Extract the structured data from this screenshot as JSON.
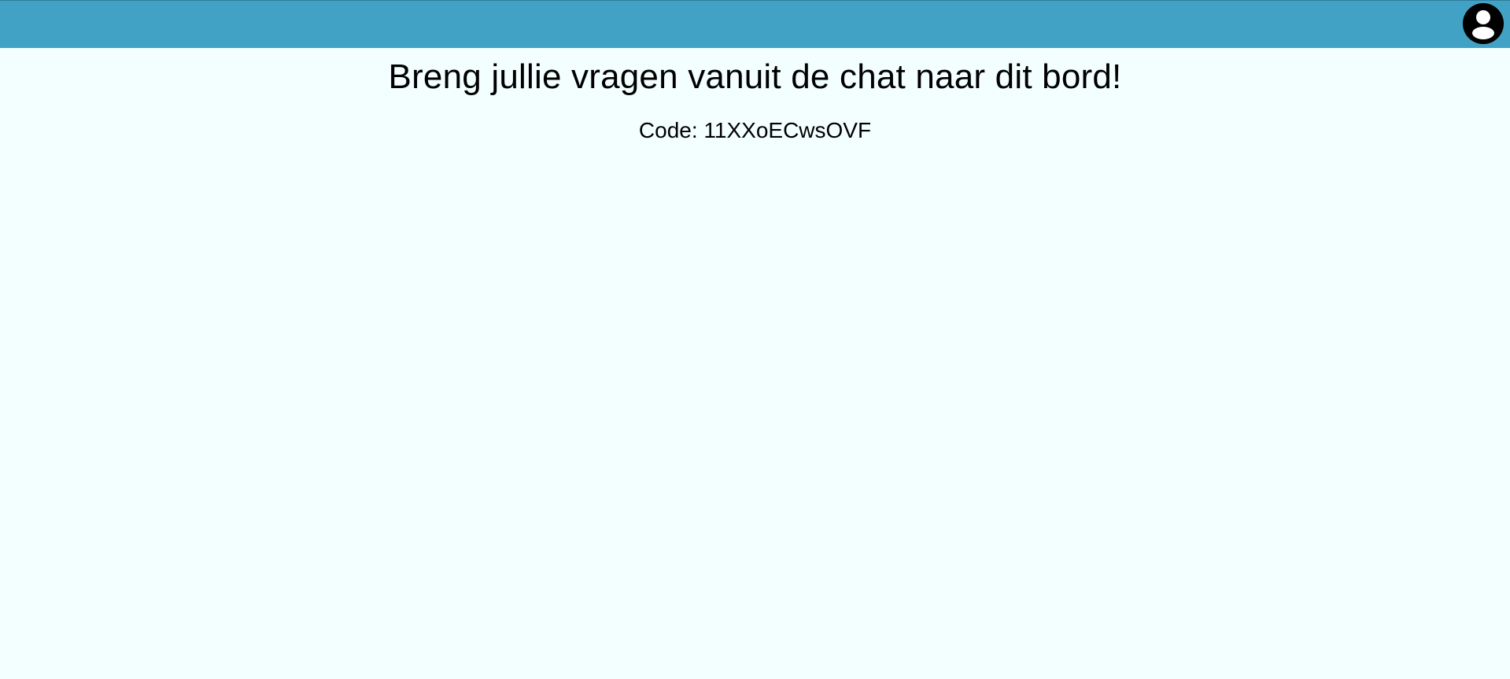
{
  "header": {
    "background_color": "#42a2c5",
    "account": {
      "icon": "user-circle-icon"
    }
  },
  "main": {
    "background_color": "#f3fffe",
    "title": "Breng jullie vragen vanuit de chat naar dit bord!",
    "code_label": "Code: 11XXoECwsOVF"
  }
}
